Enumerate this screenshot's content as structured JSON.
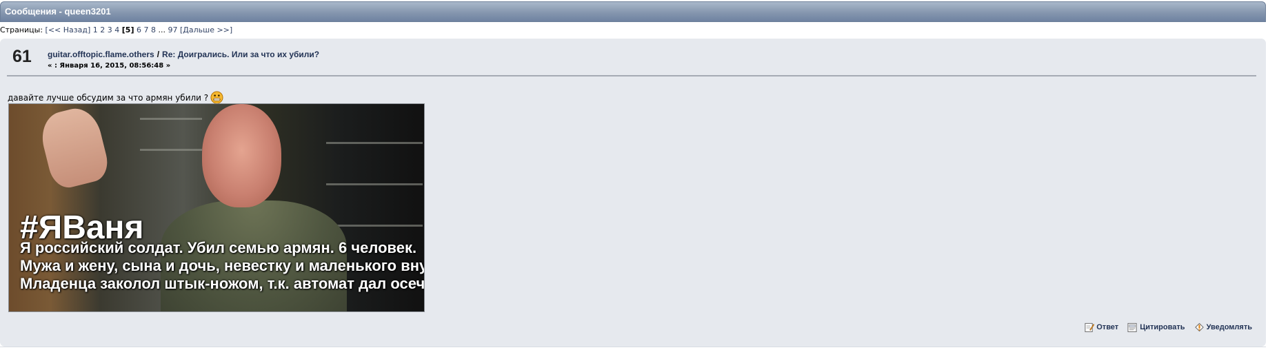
{
  "header": {
    "title": "Сообщения - queen3201"
  },
  "pagination": {
    "label": "Страницы:",
    "prev": "[<< Назад]",
    "pages_before": [
      "1",
      "2",
      "3",
      "4"
    ],
    "current": "[5]",
    "pages_after": [
      "6",
      "7",
      "8"
    ],
    "ellipsis": "...",
    "last": "97",
    "next": "[Дальше >>]"
  },
  "post": {
    "counter": "61",
    "board": "guitar.offtopic.flame.others",
    "separator": "/",
    "subject": "Re: Доигрались. Или за что их убили?",
    "date": "« : Января 16, 2015, 08:56:48 »",
    "text": "давайте лучше обсудим за что армян убили ?",
    "image_caption": {
      "hashtag": "#ЯВаня",
      "line1": "Я российский солдат. Убил семью армян. 6 человек.",
      "line2": "Мужа и жену, сына и дочь, невестку и маленького внука.",
      "line3": "Младенца заколол штык-ножом, т.к. автомат дал осечку"
    },
    "actions": {
      "reply": "Ответ",
      "quote": "Цитировать",
      "notify": "Уведомлять"
    }
  },
  "colors": {
    "header_bar": "#8596ae",
    "post_bg": "#e6e9ee",
    "link": "#223355"
  }
}
